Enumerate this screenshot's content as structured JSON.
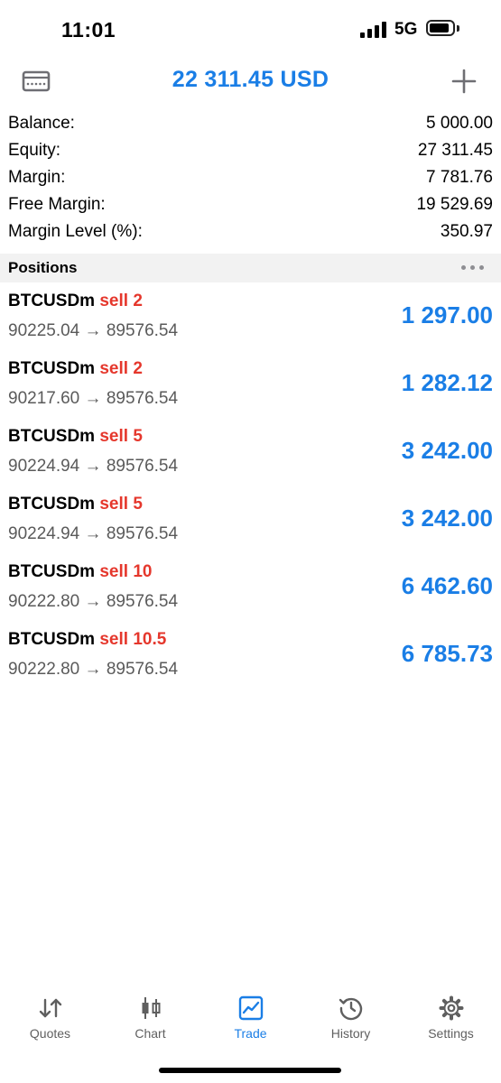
{
  "status_bar": {
    "time": "11:01",
    "network": "5G"
  },
  "header": {
    "balance_title": "22 311.45 USD",
    "accent_color": "#1a7ee6"
  },
  "summary": [
    {
      "label": "Balance:",
      "value": "5 000.00"
    },
    {
      "label": "Equity:",
      "value": "27 311.45"
    },
    {
      "label": "Margin:",
      "value": "7 781.76"
    },
    {
      "label": "Free Margin:",
      "value": "19 529.69"
    },
    {
      "label": "Margin Level (%):",
      "value": "350.97"
    }
  ],
  "positions_header": {
    "title": "Positions"
  },
  "positions": [
    {
      "symbol": "BTCUSDm",
      "side": "sell 2",
      "open_price": "90225.04",
      "arrow": "→",
      "current_price": "89576.54",
      "profit": "1 297.00"
    },
    {
      "symbol": "BTCUSDm",
      "side": "sell 2",
      "open_price": "90217.60",
      "arrow": "→",
      "current_price": "89576.54",
      "profit": "1 282.12"
    },
    {
      "symbol": "BTCUSDm",
      "side": "sell 5",
      "open_price": "90224.94",
      "arrow": "→",
      "current_price": "89576.54",
      "profit": "3 242.00"
    },
    {
      "symbol": "BTCUSDm",
      "side": "sell 5",
      "open_price": "90224.94",
      "arrow": "→",
      "current_price": "89576.54",
      "profit": "3 242.00"
    },
    {
      "symbol": "BTCUSDm",
      "side": "sell 10",
      "open_price": "90222.80",
      "arrow": "→",
      "current_price": "89576.54",
      "profit": "6 462.60"
    },
    {
      "symbol": "BTCUSDm",
      "side": "sell 10.5",
      "open_price": "90222.80",
      "arrow": "→",
      "current_price": "89576.54",
      "profit": "6 785.73"
    }
  ],
  "tabs": [
    {
      "label": "Quotes",
      "icon": "quotes-icon"
    },
    {
      "label": "Chart",
      "icon": "chart-icon"
    },
    {
      "label": "Trade",
      "icon": "trade-icon",
      "active": true
    },
    {
      "label": "History",
      "icon": "history-icon"
    },
    {
      "label": "Settings",
      "icon": "gear-icon"
    }
  ],
  "colors": {
    "sell": "#e5372c",
    "profit": "#1a7ee6",
    "section_bg": "#f2f2f2"
  }
}
